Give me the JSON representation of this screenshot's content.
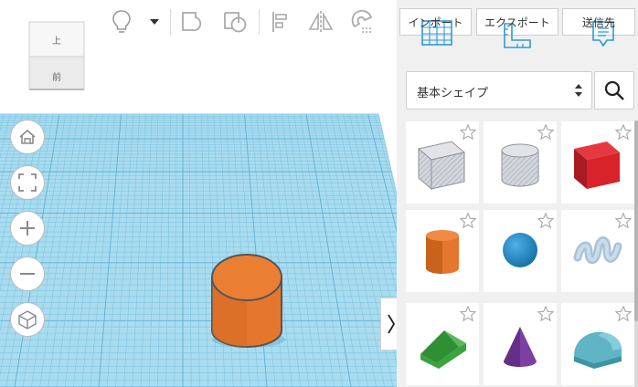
{
  "viewcube": {
    "top_label": "上",
    "front_label": "前"
  },
  "toolbar": {
    "icons": [
      "lightbulb-icon",
      "dropdown-caret-icon",
      "shape-union-icon",
      "shape-subtract-icon",
      "align-icon",
      "mirror-icon",
      "magnet-icon"
    ]
  },
  "nav_controls": [
    "home-view-icon",
    "fit-view-icon",
    "zoom-in-icon",
    "zoom-out-icon",
    "perspective-icon"
  ],
  "panel": {
    "import_label": "インポート",
    "export_label": "エクスポート",
    "send_label": "送信先",
    "category_select": "基本シェイプ",
    "shapes": [
      {
        "name": "box-hole",
        "color": "#c8ccd4"
      },
      {
        "name": "cylinder-hole",
        "color": "#c8ccd4"
      },
      {
        "name": "box",
        "color": "#d8232a"
      },
      {
        "name": "cylinder",
        "color": "#e4772d"
      },
      {
        "name": "sphere",
        "color": "#1f8ac9"
      },
      {
        "name": "scribble",
        "color": "#a9c3d8"
      },
      {
        "name": "roof",
        "color": "#3aa33f"
      },
      {
        "name": "cone",
        "color": "#7c3fa3"
      },
      {
        "name": "round-roof",
        "color": "#5fb5c6"
      }
    ]
  },
  "scene": {
    "workplane_color": "#a9dcef",
    "object": "cylinder",
    "object_color": "#e4772d"
  }
}
